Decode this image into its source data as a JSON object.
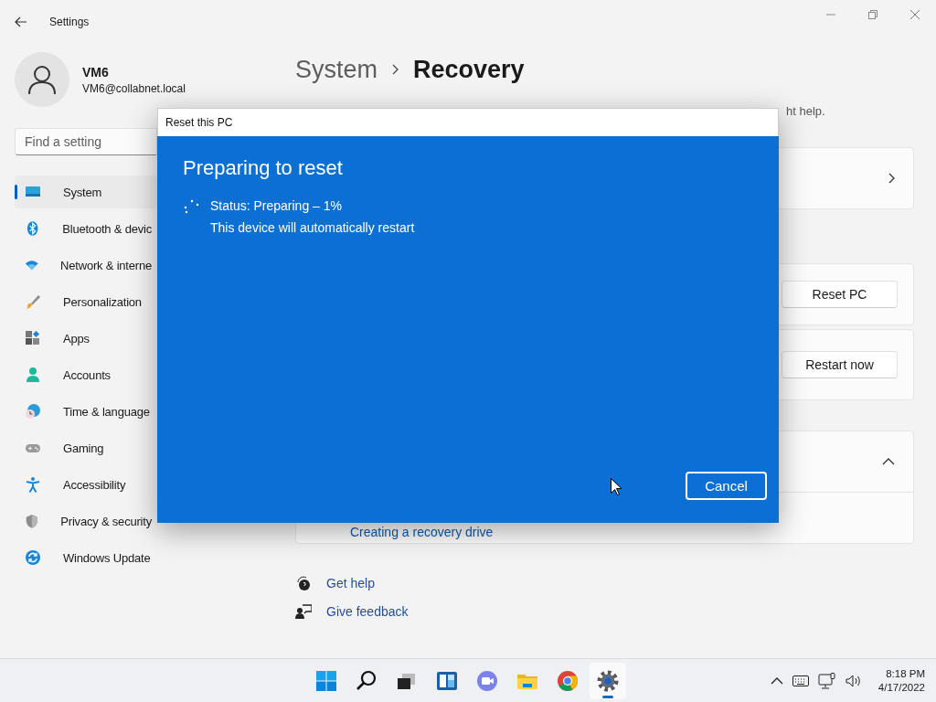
{
  "window": {
    "title": "Settings"
  },
  "user": {
    "name": "VM6",
    "email": "VM6@collabnet.local"
  },
  "search": {
    "placeholder": "Find a setting"
  },
  "sidebar": {
    "items": [
      {
        "label": "System",
        "selected": true
      },
      {
        "label": "Bluetooth & devic",
        "selected": false
      },
      {
        "label": "Network & interne",
        "selected": false
      },
      {
        "label": "Personalization",
        "selected": false
      },
      {
        "label": "Apps",
        "selected": false
      },
      {
        "label": "Accounts",
        "selected": false
      },
      {
        "label": "Time & language",
        "selected": false
      },
      {
        "label": "Gaming",
        "selected": false
      },
      {
        "label": "Accessibility",
        "selected": false
      },
      {
        "label": "Privacy & security",
        "selected": false
      },
      {
        "label": "Windows Update",
        "selected": false
      }
    ]
  },
  "page": {
    "breadcrumb": {
      "parent": "System",
      "current": "Recovery"
    },
    "description": "ht help.",
    "cards": [
      {
        "kind": "chevron"
      },
      {
        "kind": "button",
        "button": "Reset PC"
      },
      {
        "kind": "button",
        "button": "Restart now"
      },
      {
        "kind": "expander",
        "expanded": true,
        "link": "Creating a recovery drive"
      }
    ],
    "help_links": [
      "Get help",
      "Give feedback"
    ]
  },
  "dialog": {
    "title": "Reset this PC",
    "heading": "Preparing to reset",
    "status": "Status: Preparing – 1%",
    "note": "This device will automatically restart",
    "button": "Cancel"
  },
  "taskbar": {
    "apps": [
      {
        "selected": false
      },
      {
        "selected": false
      },
      {
        "selected": false
      },
      {
        "selected": false
      },
      {
        "selected": false
      },
      {
        "selected": false
      },
      {
        "selected": false
      },
      {
        "selected": true
      }
    ],
    "time": "8:18 PM",
    "date": "4/17/2022"
  }
}
